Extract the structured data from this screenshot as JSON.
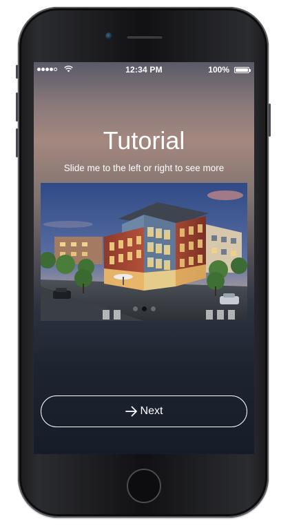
{
  "status_bar": {
    "time": "12:34 PM",
    "battery": "100%"
  },
  "tutorial": {
    "title": "Tutorial",
    "subtitle": "Slide me to the left or right to see more",
    "carousel": {
      "slide_count": 3,
      "active_index": 1
    },
    "next_label": "Next",
    "next_icon": "arrow-right-icon"
  },
  "colors": {
    "text": "#ffffff",
    "screen_top": "#a4887f",
    "screen_bottom": "#161d28"
  }
}
